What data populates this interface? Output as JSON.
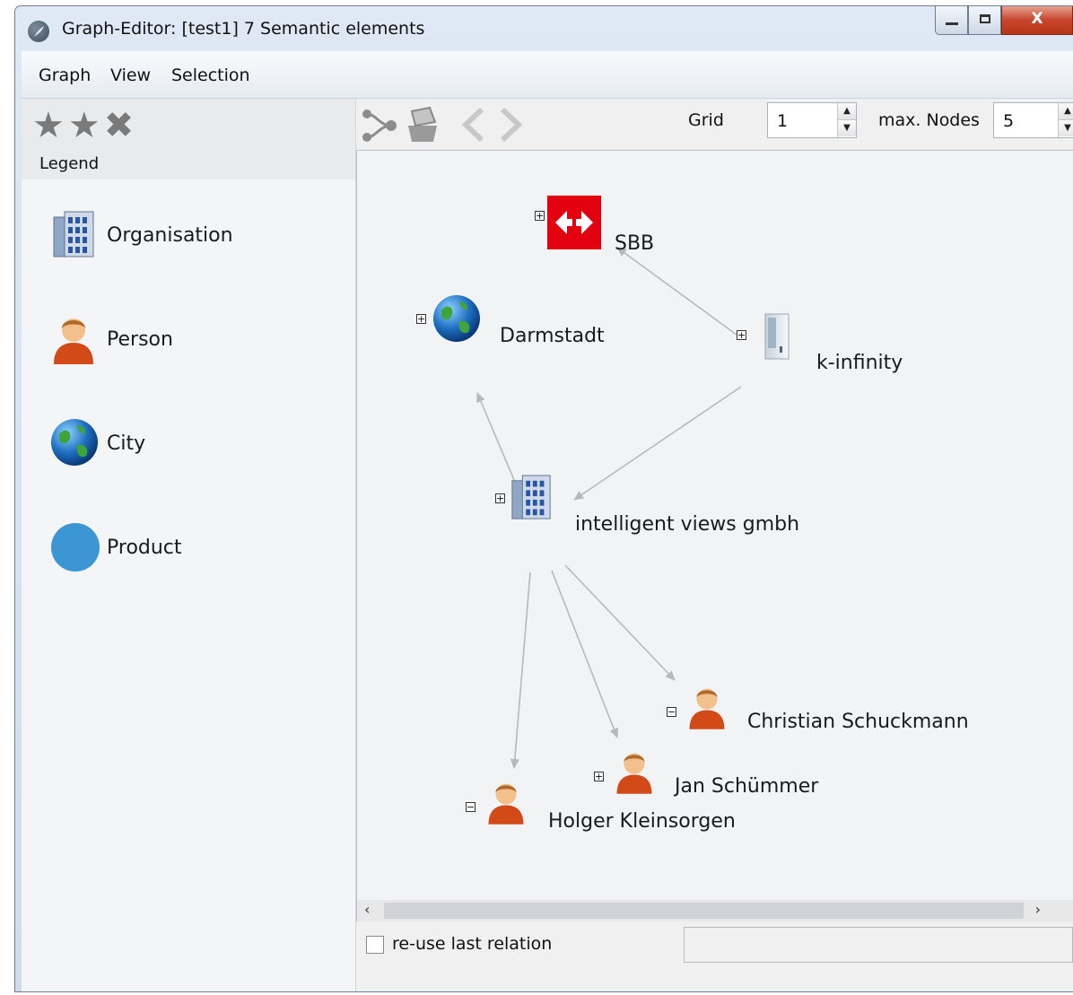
{
  "window": {
    "title": "Graph-Editor: [test1] 7 Semantic elements",
    "close_glyph": "X"
  },
  "menu": {
    "items": [
      "Graph",
      "View",
      "Selection"
    ]
  },
  "legend": {
    "title": "Legend",
    "items": [
      {
        "label": "Organisation",
        "icon": "building-icon"
      },
      {
        "label": "Person",
        "icon": "person-icon"
      },
      {
        "label": "City",
        "icon": "globe-icon"
      },
      {
        "label": "Product",
        "icon": "product-circle-icon",
        "color": "#3b96d3"
      }
    ]
  },
  "toolbar": {
    "grid_label": "Grid",
    "grid_value": "1",
    "max_nodes_label": "max. Nodes",
    "max_nodes_value": "5"
  },
  "graph": {
    "nodes": {
      "sbb": {
        "label": "SBB",
        "type": "Organisation",
        "expander": "+"
      },
      "darmstadt": {
        "label": "Darmstadt",
        "type": "City",
        "expander": "+"
      },
      "k_infinity": {
        "label": "k-infinity",
        "type": "Product",
        "expander": "+"
      },
      "intelligent_views": {
        "label": "intelligent views gmbh",
        "type": "Organisation",
        "expander": "+"
      },
      "christian": {
        "label": "Christian Schuckmann",
        "type": "Person",
        "expander": "−"
      },
      "jan": {
        "label": "Jan Schümmer",
        "type": "Person",
        "expander": "+"
      },
      "holger": {
        "label": "Holger Kleinsorgen",
        "type": "Person",
        "expander": "−"
      }
    },
    "edges": [
      {
        "from": "k_infinity",
        "to": "sbb"
      },
      {
        "from": "k_infinity",
        "to": "intelligent_views"
      },
      {
        "from": "intelligent_views",
        "to": "darmstadt"
      },
      {
        "from": "intelligent_views",
        "to": "christian"
      },
      {
        "from": "intelligent_views",
        "to": "jan"
      },
      {
        "from": "intelligent_views",
        "to": "holger"
      }
    ],
    "colors": {
      "edge": "#b8b8b8",
      "sbb_red": "#e3000f",
      "product": "#3b96d3"
    }
  },
  "statusbar": {
    "reuse_label": "re-use last relation",
    "reuse_checked": false
  }
}
